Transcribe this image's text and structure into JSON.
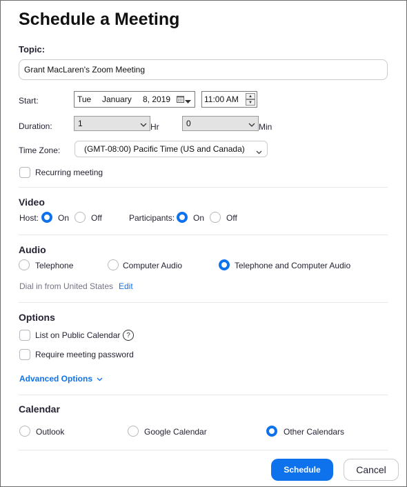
{
  "title": "Schedule a Meeting",
  "topic": {
    "label": "Topic:",
    "value": "Grant MacLaren's Zoom Meeting"
  },
  "start": {
    "label": "Start:",
    "day": "Tue",
    "month": "January",
    "date": "8, 2019",
    "time": "11:00 AM"
  },
  "duration": {
    "label": "Duration:",
    "hours": "1",
    "hours_unit": "Hr",
    "minutes": "0",
    "minutes_unit": "Min"
  },
  "timezone": {
    "label": "Time Zone:",
    "value": "(GMT-08:00) Pacific Time (US and Canada)"
  },
  "recurring": {
    "label": "Recurring meeting",
    "checked": false
  },
  "video": {
    "heading": "Video",
    "host_label": "Host:",
    "participants_label": "Participants:",
    "on": "On",
    "off": "Off"
  },
  "audio": {
    "heading": "Audio",
    "telephone": "Telephone",
    "computer": "Computer Audio",
    "both": "Telephone and Computer Audio",
    "selected": "Telephone and Computer Audio",
    "dial_in": "Dial in from United States",
    "edit": "Edit"
  },
  "options": {
    "heading": "Options",
    "public_calendar": "List on Public Calendar",
    "help_symbol": "?",
    "password": "Require meeting password",
    "advanced": "Advanced Options"
  },
  "calendar": {
    "heading": "Calendar",
    "outlook": "Outlook",
    "google": "Google Calendar",
    "other": "Other Calendars",
    "selected": "Other Calendars"
  },
  "buttons": {
    "schedule": "Schedule",
    "cancel": "Cancel"
  },
  "colors": {
    "accent": "#0e72ed",
    "text": "#232333",
    "muted": "#747487"
  }
}
